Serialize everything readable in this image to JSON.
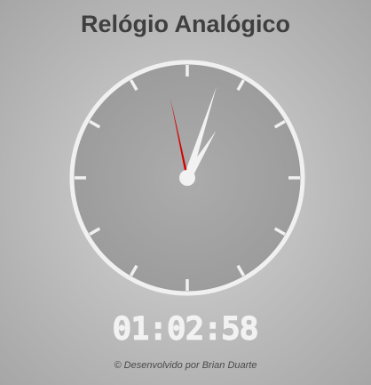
{
  "page": {
    "title": "Relógio Analógico",
    "credit": "© Desenvolvido por Brian Duarte"
  },
  "clock": {
    "time_text": "01:02:58",
    "hours": 1,
    "minutes": 2,
    "seconds": 58,
    "colors": {
      "face": "#a3a3a3",
      "rim": "#f0f0f0",
      "hands": "#f2f2f2",
      "second_hand": "#d40000"
    }
  },
  "icons": {
    "clock": "analog-clock-icon"
  }
}
